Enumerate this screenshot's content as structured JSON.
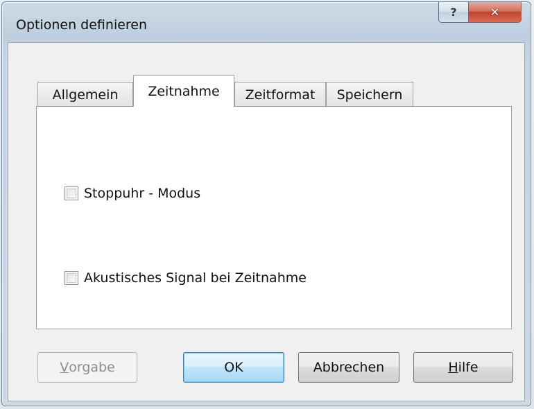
{
  "window": {
    "title": "Optionen definieren",
    "help_symbol": "?",
    "close_symbol": "✕"
  },
  "tabs": [
    {
      "label": "Allgemein",
      "active": false
    },
    {
      "label": "Zeitnahme",
      "active": true
    },
    {
      "label": "Zeitformat",
      "active": false
    },
    {
      "label": "Speichern",
      "active": false
    }
  ],
  "options": [
    {
      "label": "Stoppuhr - Modus",
      "checked": false
    },
    {
      "label": "Akustisches Signal bei Zeitnahme",
      "checked": false
    }
  ],
  "buttons": {
    "vorgabe": {
      "accel": "V",
      "rest": "orgabe",
      "enabled": false
    },
    "ok": {
      "label": "OK"
    },
    "abbrechen": {
      "label": "Abbrechen"
    },
    "hilfe": {
      "accel": "H",
      "rest": "ilfe"
    }
  },
  "colors": {
    "close_button": "#c0432c",
    "default_button_border": "#3c7fb1"
  },
  "icons": {
    "help": "help-icon",
    "close": "close-icon"
  }
}
